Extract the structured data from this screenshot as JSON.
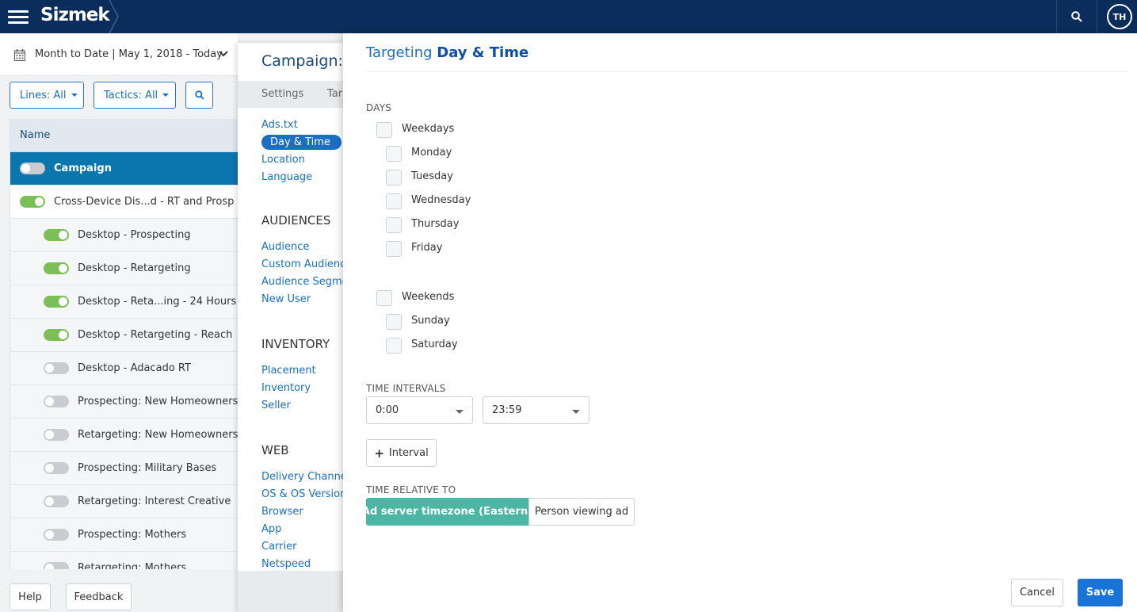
{
  "app": {
    "logo": "Sizmek",
    "avatar_initials": "TH"
  },
  "left": {
    "date_range": "Month to Date | May 1, 2018 - Today",
    "filters": {
      "lines": "Lines: All",
      "tactics": "Tactics: All"
    },
    "list_header": "Name",
    "rows": [
      {
        "label": "Campaign",
        "on": false,
        "level": 0,
        "selected": true
      },
      {
        "label": "Cross-Device Dis...d - RT and Prosp",
        "on": true,
        "level": 0
      },
      {
        "label": "Desktop - Prospecting",
        "on": true,
        "level": 1
      },
      {
        "label": "Desktop - Retargeting",
        "on": true,
        "level": 1
      },
      {
        "label": "Desktop - Reta...ing - 24 Hours",
        "on": true,
        "level": 1
      },
      {
        "label": "Desktop - Retargeting - Reach",
        "on": true,
        "level": 1
      },
      {
        "label": "Desktop - Adacado RT",
        "on": false,
        "level": 1
      },
      {
        "label": "Prospecting: New Homeowners",
        "on": false,
        "level": 1
      },
      {
        "label": "Retargeting: New Homeowners",
        "on": false,
        "level": 1
      },
      {
        "label": "Prospecting: Military Bases",
        "on": false,
        "level": 1
      },
      {
        "label": "Retargeting: Interest Creative",
        "on": false,
        "level": 1
      },
      {
        "label": "Prospecting: Mothers",
        "on": false,
        "level": 1
      },
      {
        "label": "Retargeting: Mothers",
        "on": false,
        "level": 1
      }
    ],
    "footer": {
      "help": "Help",
      "feedback": "Feedback"
    }
  },
  "middle": {
    "title": "Campaign:",
    "tabs": [
      "Settings",
      "Tar"
    ],
    "links_top": [
      "Ads.txt",
      "Day & Time",
      "Location",
      "Language"
    ],
    "active_link": "Day & Time",
    "sections": [
      {
        "title": "AUDIENCES",
        "links": [
          "Audience",
          "Custom Audience",
          "Audience Segme",
          "New User"
        ]
      },
      {
        "title": "INVENTORY",
        "links": [
          "Placement",
          "Inventory",
          "Seller"
        ]
      },
      {
        "title": "WEB",
        "links": [
          "Delivery Channel",
          "OS & OS Version",
          "Browser",
          "App",
          "Carrier",
          "Netspeed"
        ]
      }
    ]
  },
  "right": {
    "title_prefix": "Targeting",
    "title_strong": "Day & Time",
    "days_label": "DAYS",
    "weekdays": {
      "label": "Weekdays",
      "days": [
        "Monday",
        "Tuesday",
        "Wednesday",
        "Thursday",
        "Friday"
      ]
    },
    "weekends": {
      "label": "Weekends",
      "days": [
        "Sunday",
        "Saturday"
      ]
    },
    "time_intervals_label": "TIME INTERVALS",
    "start_time": "0:00",
    "end_time": "23:59",
    "interval_button": "Interval",
    "time_relative_label": "TIME RELATIVE TO",
    "relative_options": [
      "Ad server timezone (Eastern)",
      "Person viewing ad"
    ],
    "relative_selected": "Ad server timezone (Eastern)",
    "cancel": "Cancel",
    "save": "Save"
  }
}
